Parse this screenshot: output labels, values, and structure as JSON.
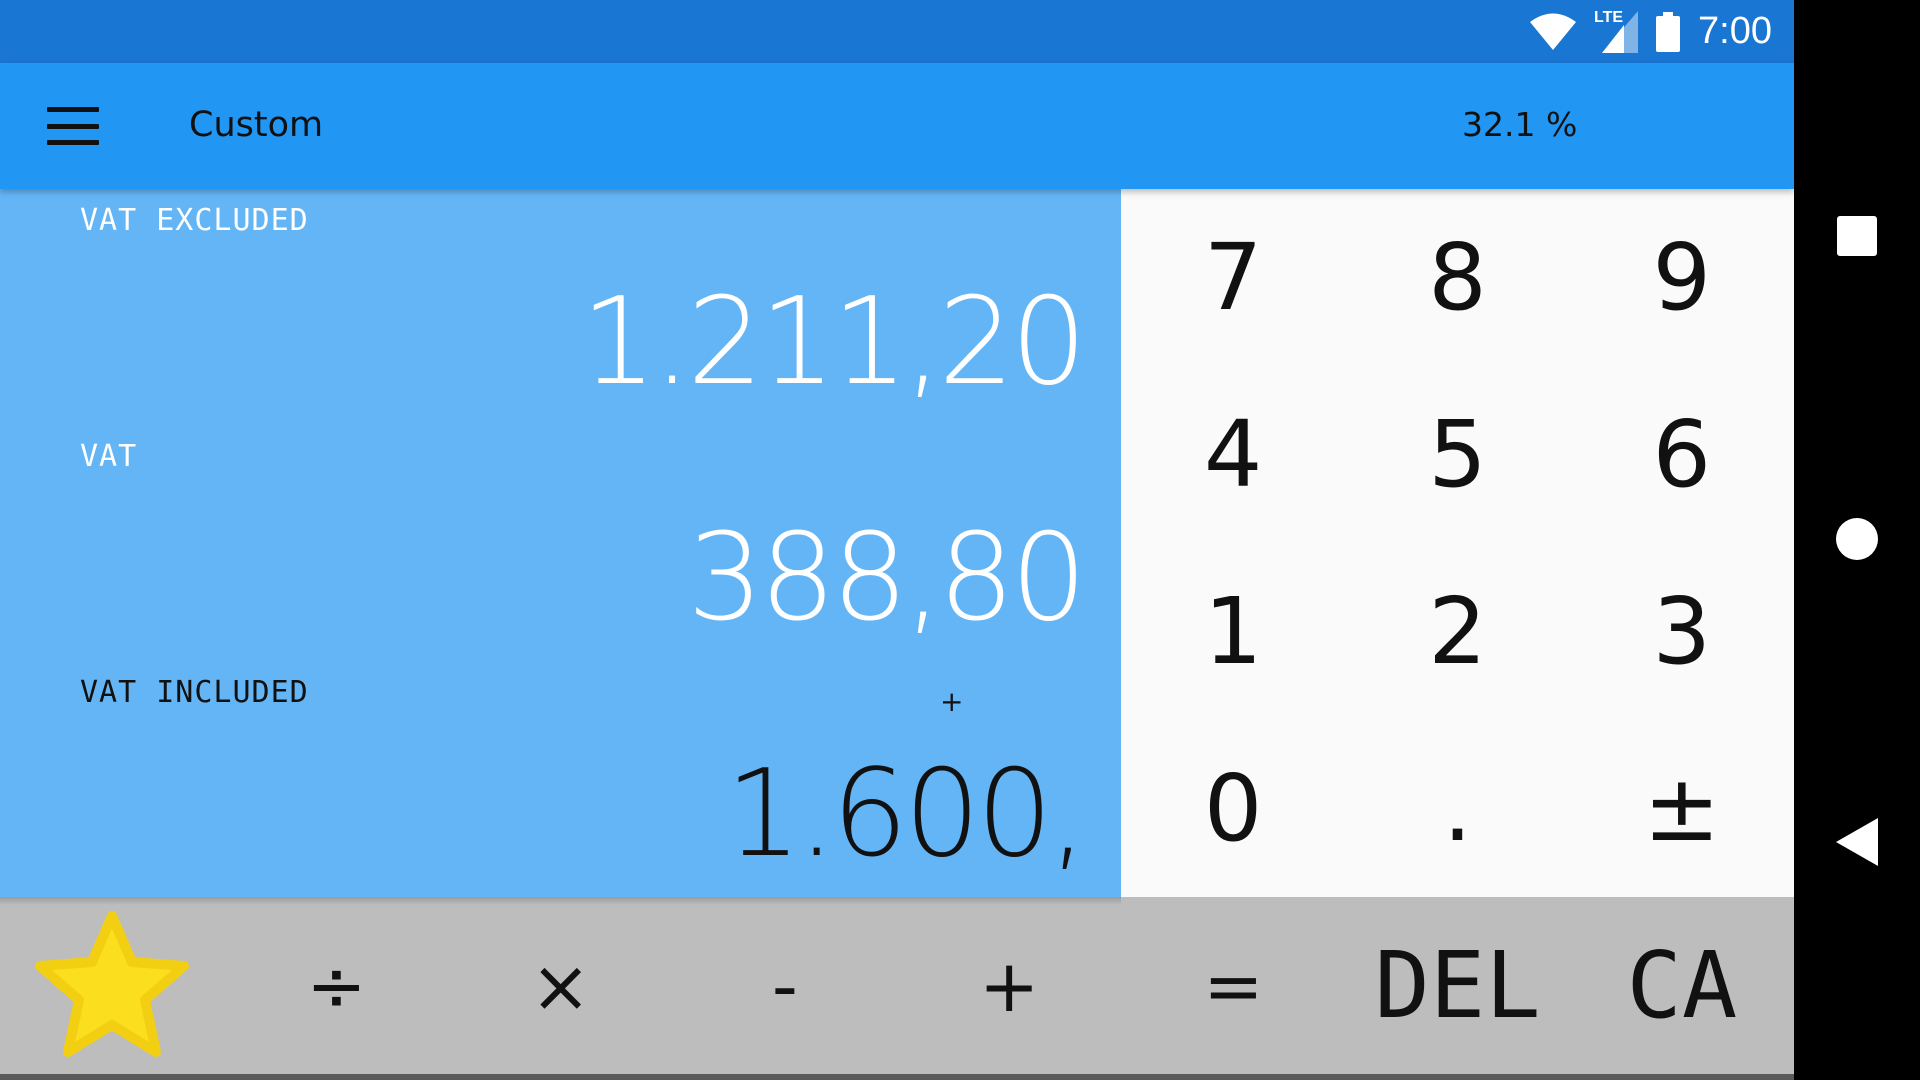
{
  "status_bar": {
    "time": "7:00",
    "network_label": "LTE",
    "icons": [
      "wifi-icon",
      "cell-signal-icon",
      "battery-icon"
    ]
  },
  "app_bar": {
    "title": "Custom",
    "rate": "32.1 %"
  },
  "display": {
    "vat_excluded_label": "VAT EXCLUDED",
    "vat_excluded_value": "1.211,20",
    "vat_label": "VAT",
    "vat_value": "388,80",
    "vat_included_label": "VAT INCLUDED",
    "operator_indicator": "+",
    "vat_included_value": "1.600,"
  },
  "keypad": {
    "keys": [
      "7",
      "8",
      "9",
      "4",
      "5",
      "6",
      "1",
      "2",
      "3",
      "0",
      ".",
      "±"
    ]
  },
  "operators": {
    "divide": "÷",
    "multiply": "×",
    "minus": "-",
    "plus": "+",
    "equals": "=",
    "delete": "DEL",
    "clear_all": "CA"
  },
  "colors": {
    "status_bar": "#1976D2",
    "app_bar": "#2196F3",
    "display": "#64B5F6",
    "keypad": "#FAFAFA",
    "operator_row": "#BDBDBD",
    "star": "#FBDF1E"
  }
}
